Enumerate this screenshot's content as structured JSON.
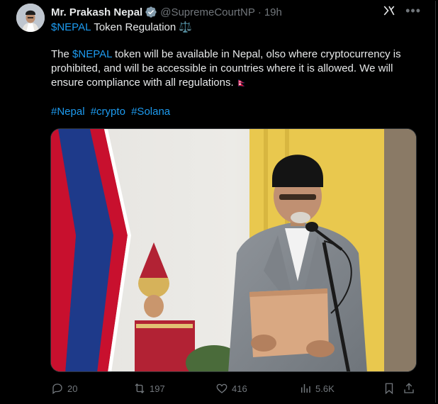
{
  "tweet": {
    "author_name": "Mr. Prakash Nepal",
    "handle": "@SupremeCourtNP",
    "separator": "·",
    "time": "19h",
    "title_cashtag": "$NEPAL",
    "title_rest": " Token Regulation",
    "title_emoji": "⚖️",
    "body_prefix": "The ",
    "body_cashtag": "$NEPAL",
    "body_rest": " token will be available in Nepal, olso where cryptocurrency is prohibited, and will be accessible in countries where it is allowed. We will ensure compliance with all regulations.",
    "flag_emoji": "🇳🇵",
    "hashtags": [
      "#Nepal",
      "#crypto",
      "#Solana"
    ]
  },
  "actions": {
    "replies": "20",
    "reposts": "197",
    "likes": "416",
    "views": "5.6K"
  },
  "icons": {
    "verified": "verified-badge-icon",
    "grok": "grok-icon",
    "more": "more-icon",
    "reply": "reply-icon",
    "repost": "repost-icon",
    "like": "like-icon",
    "views": "views-icon",
    "bookmark": "bookmark-icon",
    "share": "share-icon"
  },
  "colors": {
    "background": "#000000",
    "text": "#e7e9ea",
    "muted": "#71767b",
    "link": "#1d9bf0",
    "border": "#2f3336"
  }
}
